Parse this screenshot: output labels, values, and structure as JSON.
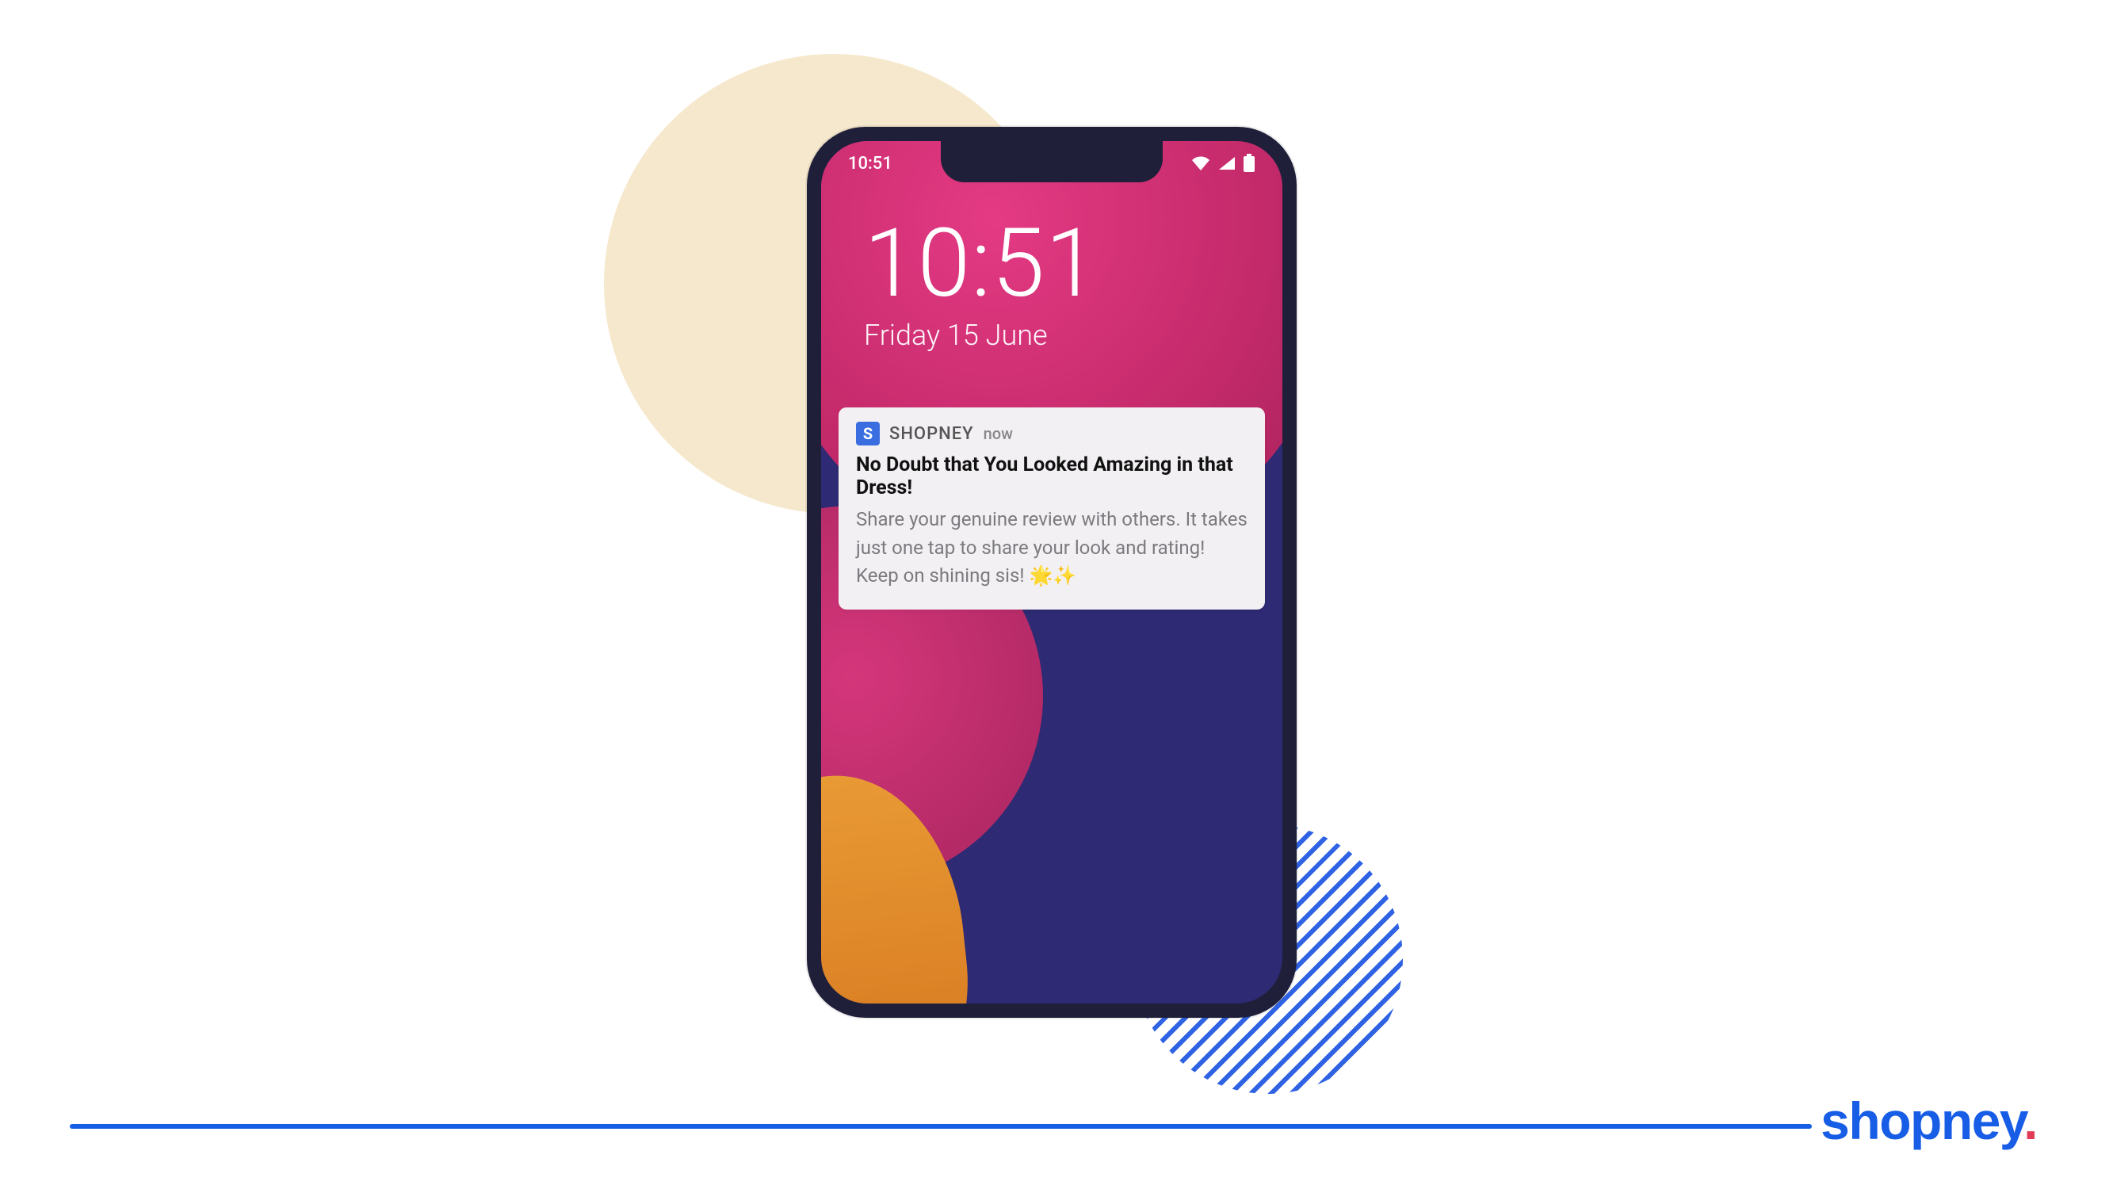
{
  "status": {
    "time": "10:51"
  },
  "lockscreen": {
    "time": "10:51",
    "date": "Friday 15 June"
  },
  "notification": {
    "app_initial": "S",
    "app_name": "SHOPNEY",
    "when": "now",
    "title": "No Doubt that You Looked Amazing in that Dress!",
    "body": "Share your genuine review with others. It takes just one tap to share your look and rating! Keep on shining sis! 🌟✨"
  },
  "brand": {
    "name": "shopney",
    "dot": "."
  }
}
